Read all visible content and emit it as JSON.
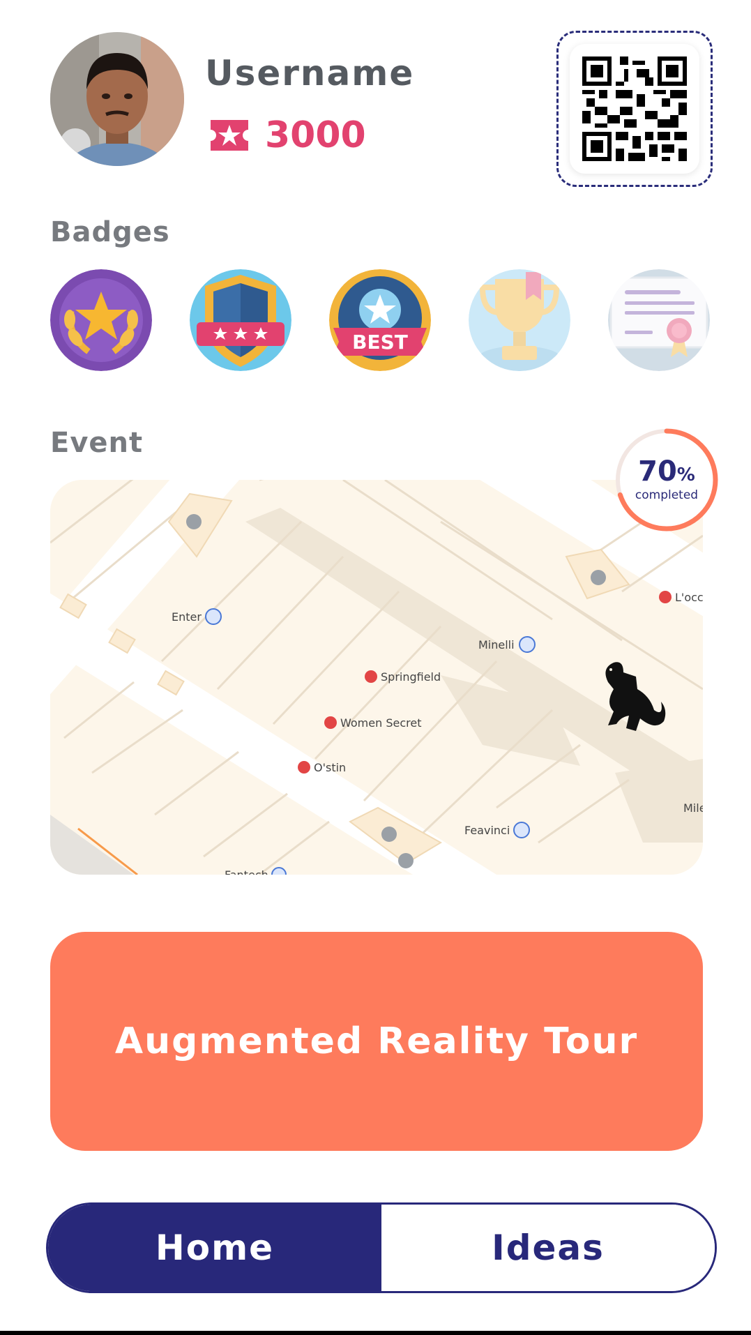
{
  "profile": {
    "username": "Username",
    "points": "3000",
    "points_icon": "ticket-star-icon",
    "avatar_icon": "user-photo"
  },
  "qr": {
    "icon": "qr-code-icon"
  },
  "badges": {
    "title": "Badges",
    "items": [
      {
        "icon": "laurel-star-badge",
        "earned": true
      },
      {
        "icon": "shield-stars-badge",
        "earned": true
      },
      {
        "icon": "best-star-badge",
        "earned": true,
        "label": "BEST"
      },
      {
        "icon": "trophy-badge",
        "earned": false
      },
      {
        "icon": "certificate-badge",
        "earned": false
      }
    ]
  },
  "event": {
    "title": "Event",
    "progress": {
      "value": "70",
      "unit": "%",
      "label": "completed",
      "fraction": 0.7
    },
    "map": {
      "places": [
        "Enter",
        "Minelli",
        "Springfield",
        "Women Secret",
        "O'stin",
        "Feavinci",
        "L'occ",
        "Mile",
        "Fantech"
      ],
      "marker_icon": "godzilla-icon"
    }
  },
  "actions": {
    "ar_tour": "Augmented Reality Tour"
  },
  "nav": {
    "home": "Home",
    "ideas": "Ideas",
    "active": "home"
  },
  "colors": {
    "accent": "#fe7b5c",
    "navy": "#28287a",
    "points": "#e2426f",
    "text_gray": "#555a60",
    "map_bg": "#fdf6ea"
  }
}
